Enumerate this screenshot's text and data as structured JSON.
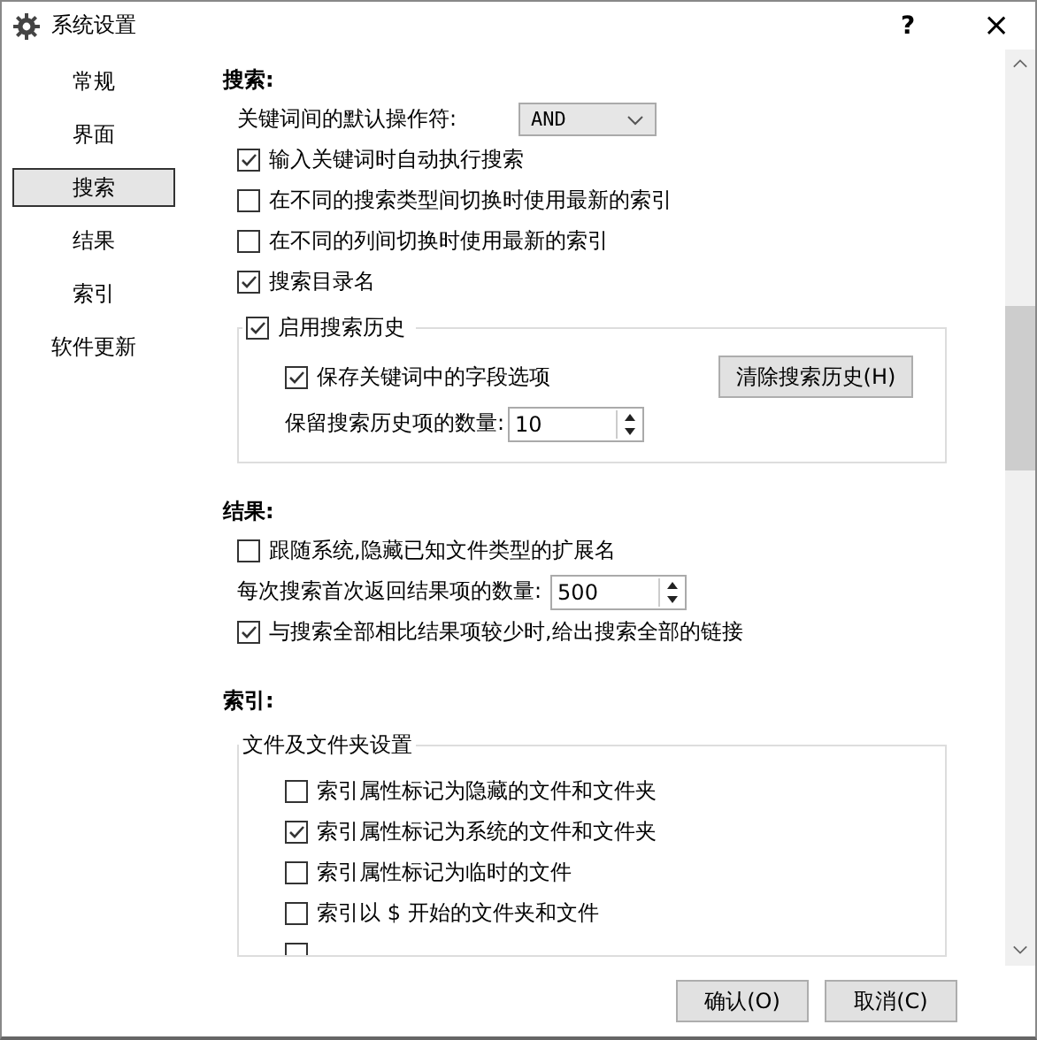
{
  "window": {
    "title": "系统设置",
    "help": "?",
    "close": "×"
  },
  "sidebar": {
    "items": [
      {
        "label": "常规",
        "selected": false
      },
      {
        "label": "界面",
        "selected": false
      },
      {
        "label": "搜索",
        "selected": true
      },
      {
        "label": "结果",
        "selected": false
      },
      {
        "label": "索引",
        "selected": false
      },
      {
        "label": "软件更新",
        "selected": false
      }
    ]
  },
  "search": {
    "heading": "搜索:",
    "operator_label": "关键词间的默认操作符:",
    "operator_value": "AND",
    "options": [
      {
        "label": "输入关键词时自动执行搜索",
        "checked": true
      },
      {
        "label": "在不同的搜索类型间切换时使用最新的索引",
        "checked": false
      },
      {
        "label": "在不同的列间切换时使用最新的索引",
        "checked": false
      },
      {
        "label": "搜索目录名",
        "checked": true
      }
    ],
    "history": {
      "label": "启用搜索历史",
      "checked": true,
      "save_fields": {
        "label": "保存关键词中的字段选项",
        "checked": true
      },
      "clear_button": "清除搜索历史(H)",
      "count_label": "保留搜索历史项的数量:",
      "count_value": "10"
    }
  },
  "results": {
    "heading": "结果:",
    "hide_ext": {
      "label": "跟随系统,隐藏已知文件类型的扩展名",
      "checked": false
    },
    "count_label": "每次搜索首次返回结果项的数量:",
    "count_value": "500",
    "link_all": {
      "label": "与搜索全部相比结果项较少时,给出搜索全部的链接",
      "checked": true
    }
  },
  "index": {
    "heading": "索引:",
    "group_title": "文件及文件夹设置",
    "options": [
      {
        "label": "索引属性标记为隐藏的文件和文件夹",
        "checked": false
      },
      {
        "label": "索引属性标记为系统的文件和文件夹",
        "checked": true
      },
      {
        "label": "索引属性标记为临时的文件",
        "checked": false
      },
      {
        "label": "索引以 $ 开始的文件夹和文件",
        "checked": false
      },
      {
        "checked": false
      }
    ]
  },
  "buttons": [
    "确认(O)",
    "取消(C)"
  ]
}
